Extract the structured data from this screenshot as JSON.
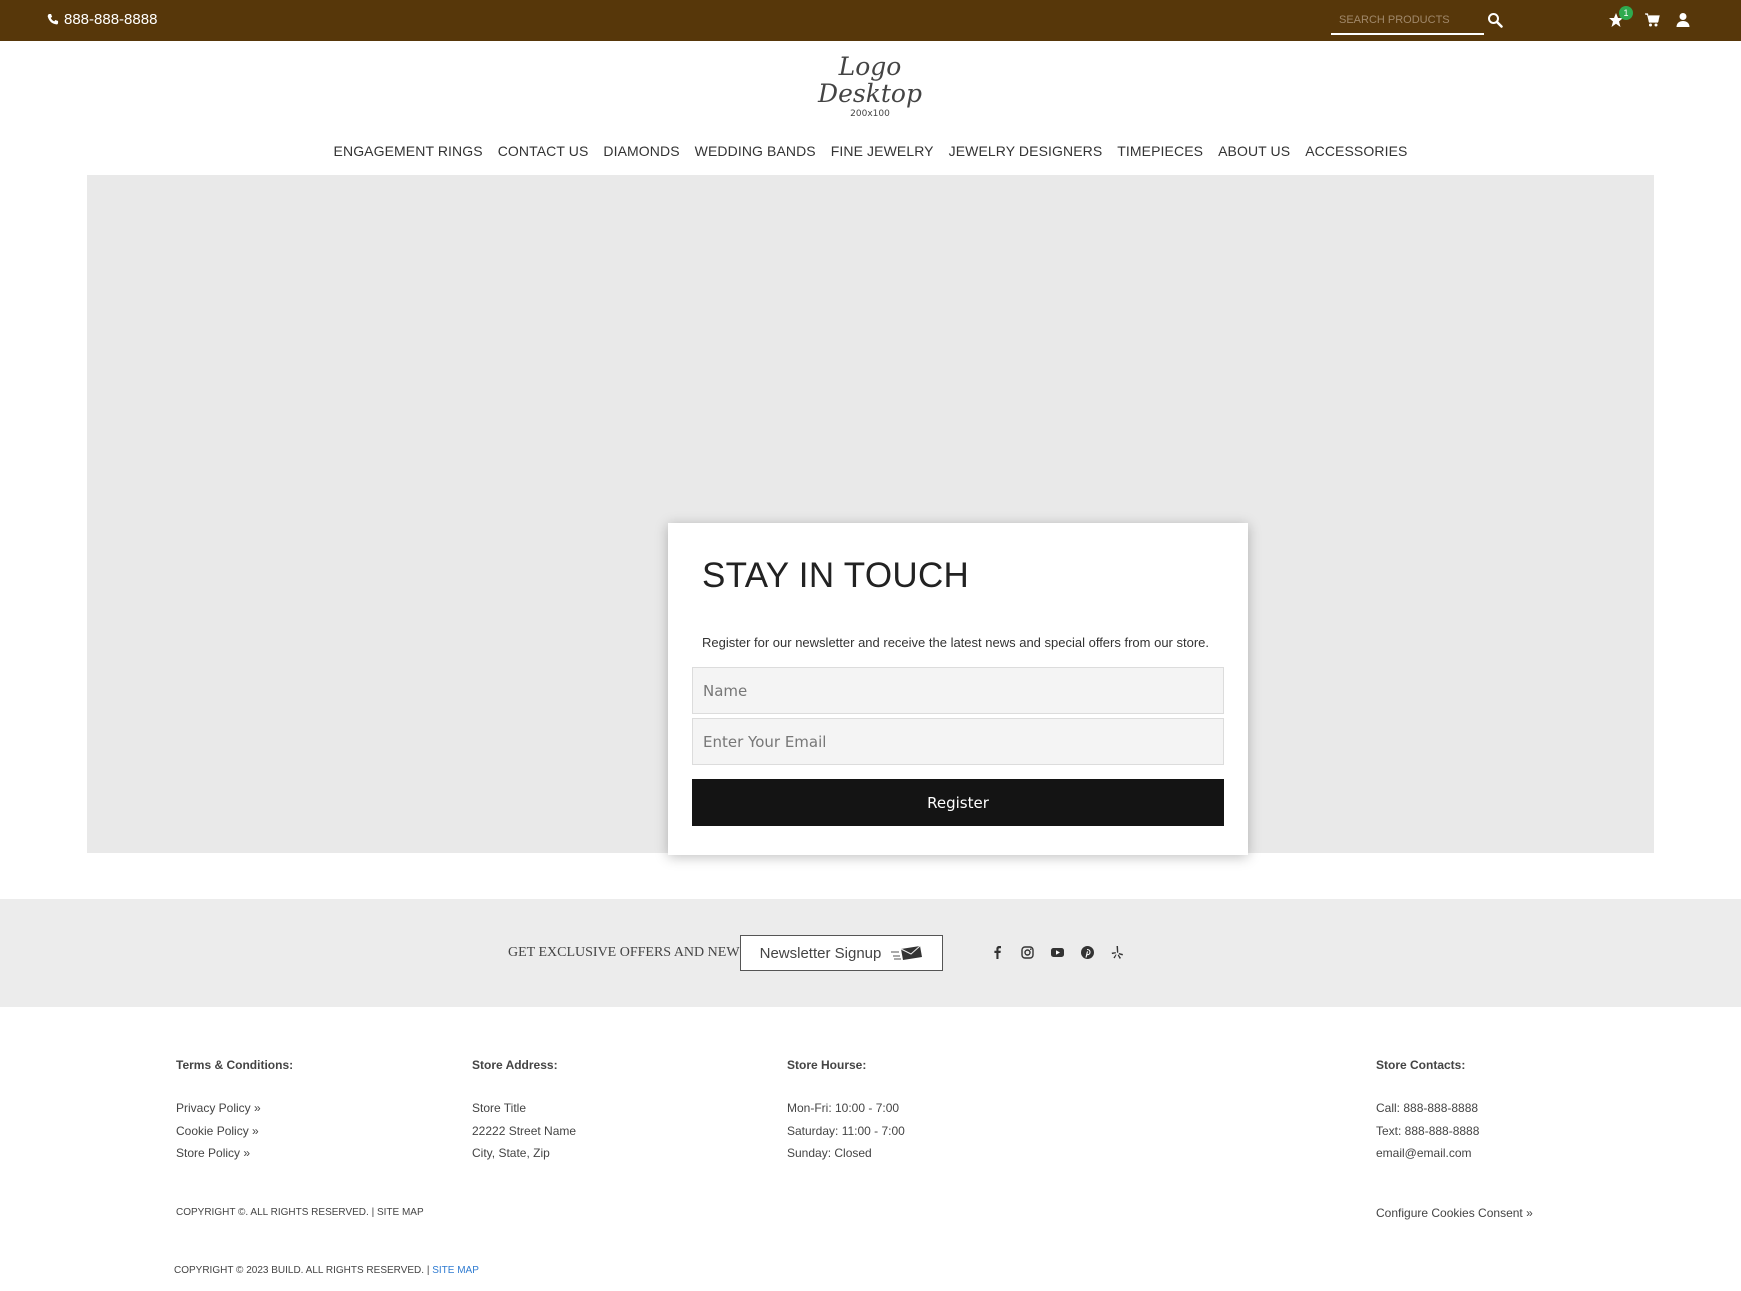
{
  "topbar": {
    "phone": "888-888-8888",
    "search_placeholder": "SEARCH PRODUCTS",
    "favorites_count": "1",
    "bg_color": "#57370a"
  },
  "logo": {
    "line1": "Logo",
    "line2": "Desktop",
    "size": "200x100"
  },
  "nav": {
    "items": [
      "ENGAGEMENT RINGS",
      "CONTACT US",
      "DIAMONDS",
      "WEDDING BANDS",
      "FINE JEWELRY",
      "JEWELRY DESIGNERS",
      "TIMEPIECES",
      "ABOUT US",
      "ACCESSORIES"
    ]
  },
  "signup": {
    "title": "STAY IN TOUCH",
    "description": "Register for our newsletter and receive the latest news and special offers from our store.",
    "name_placeholder": "Name",
    "email_placeholder": "Enter Your Email",
    "button": "Register"
  },
  "strip": {
    "text": "GET EXCLUSIVE OFFERS AND NEWS.",
    "button": "Newsletter Signup",
    "socials": [
      "facebook-icon",
      "instagram-icon",
      "youtube-icon",
      "pinterest-icon",
      "yelp-icon"
    ]
  },
  "footer": {
    "terms": {
      "title": "Terms & Conditions:",
      "links": [
        "Privacy Policy »",
        "Cookie Policy »",
        "Store Policy »"
      ]
    },
    "address": {
      "title": "Store Address:",
      "lines": [
        "Store Title",
        "22222 Street Name",
        "City, State, Zip"
      ]
    },
    "hours": {
      "title": "Store Hourse:",
      "lines": [
        "Mon-Fri: 10:00 - 7:00",
        "Saturday: 11:00 - 7:00",
        "Sunday: Closed"
      ]
    },
    "contacts": {
      "title": "Store Contacts:",
      "lines": [
        "Call: 888-888-8888",
        "Text: 888-888-8888",
        "email@email.com"
      ]
    },
    "copyright1": "COPYRIGHT ©. ALL RIGHTS RESERVED. | SITE MAP",
    "cookies": "Configure Cookies Consent »",
    "copyright2": "COPYRIGHT © 2023 BUILD. ALL RIGHTS RESERVED. |",
    "sitemap": "SITE MAP"
  }
}
